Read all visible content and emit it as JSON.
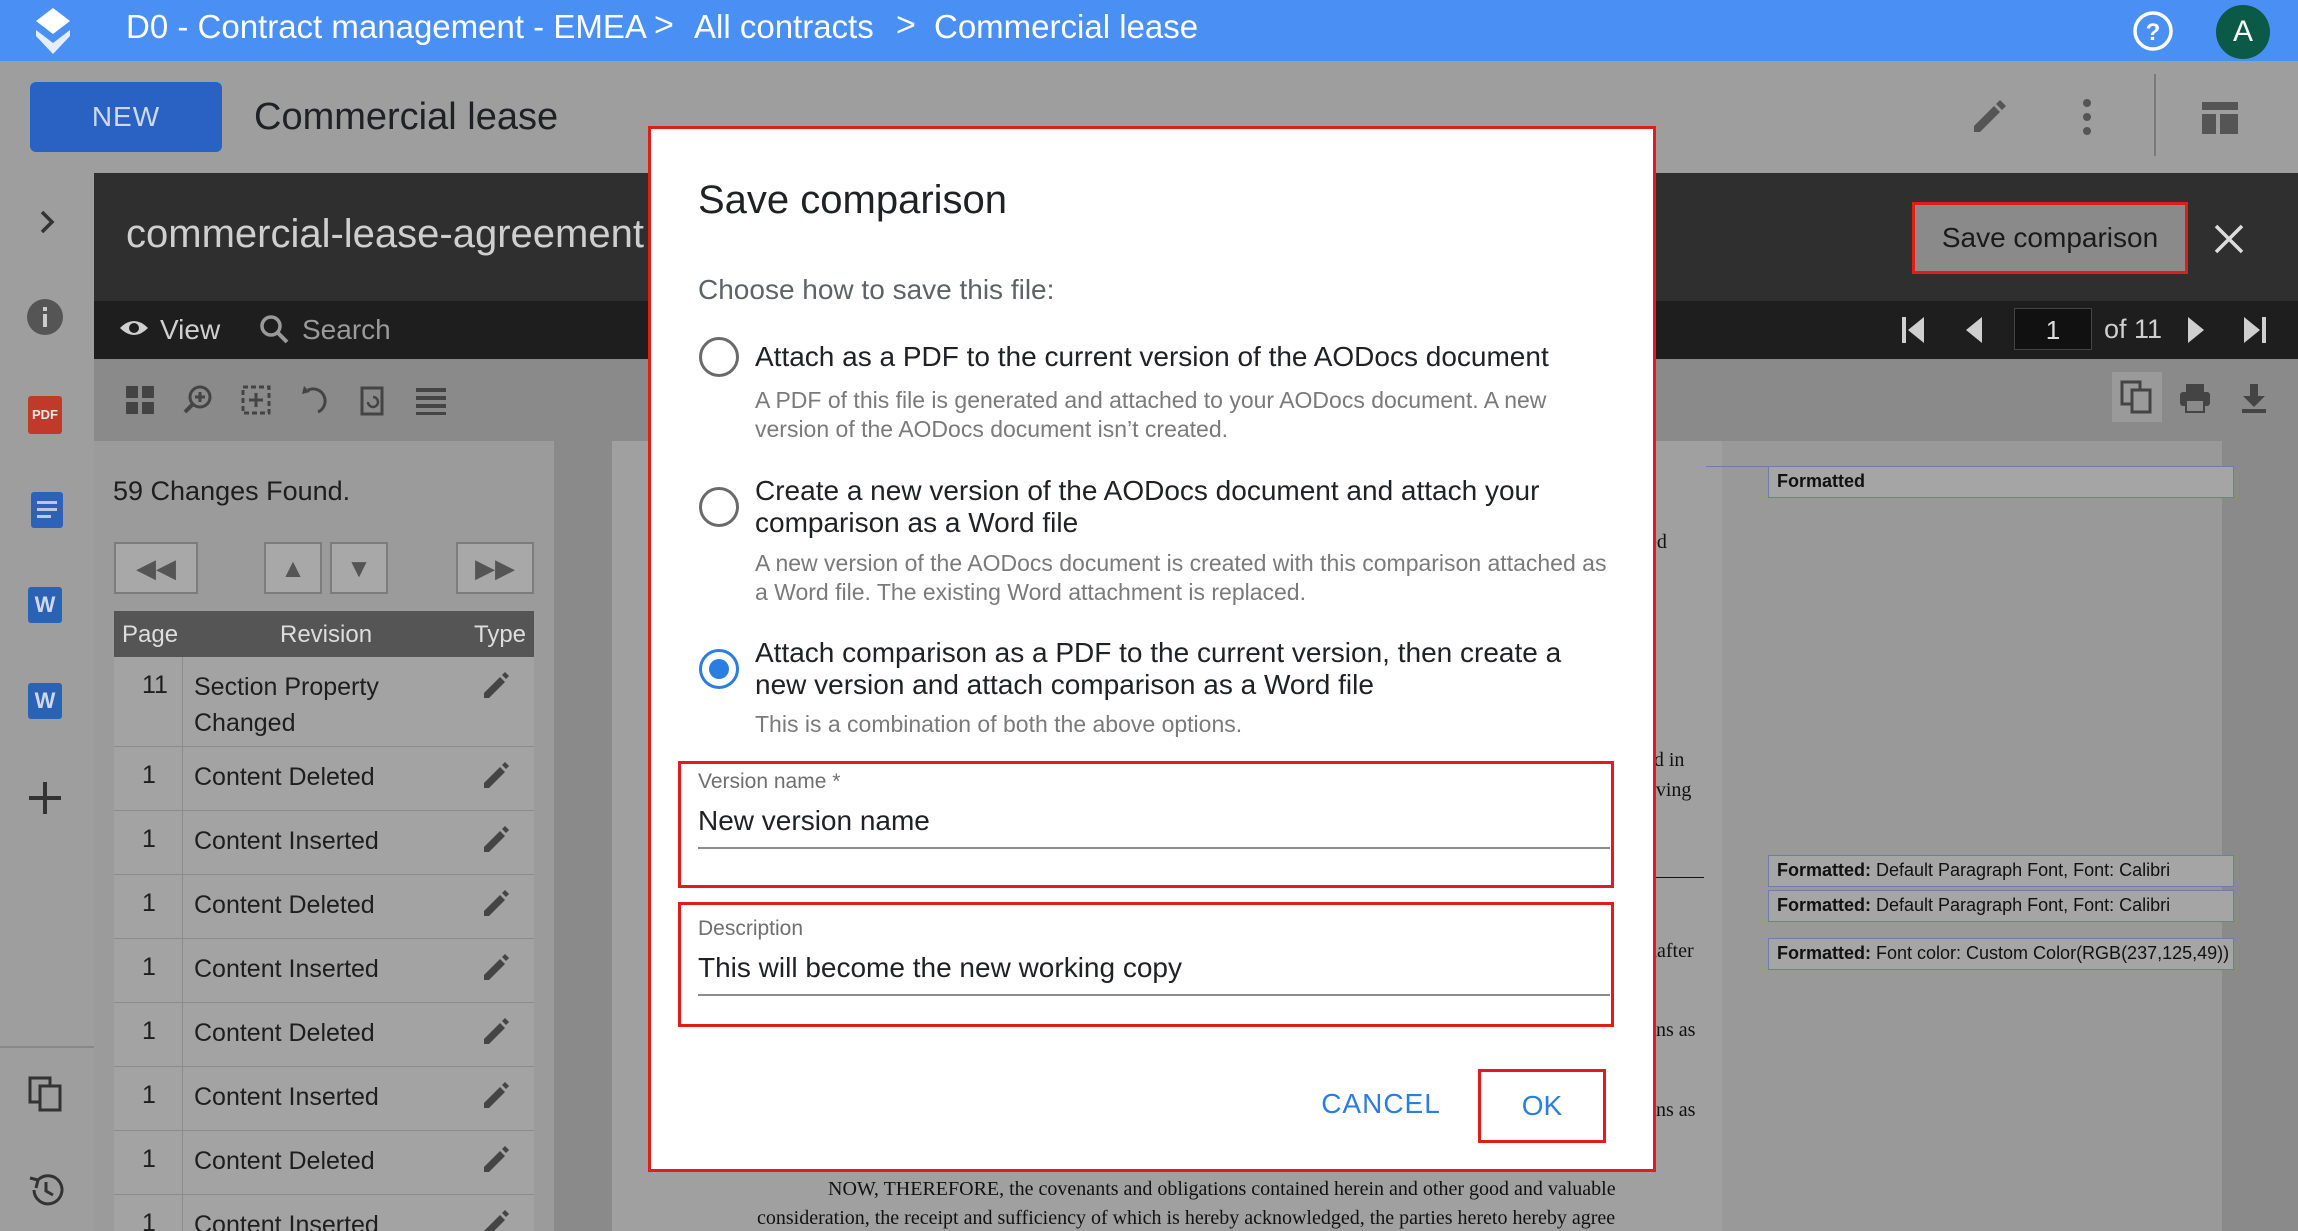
{
  "topbar": {
    "breadcrumbs": [
      "D0 - Contract management - EMEA",
      "All contracts",
      "Commercial lease"
    ],
    "separator": ">",
    "avatar_letter": "A",
    "icons": [
      "app-logo-icon",
      "help-icon"
    ]
  },
  "toolbar": {
    "new_label": "NEW",
    "doc_title": "Commercial lease",
    "icons": [
      "edit-icon",
      "more-vert-icon",
      "layout-icon"
    ]
  },
  "leftrail": {
    "icons": [
      "chevron-right-icon",
      "info-icon",
      "pdf-file-icon",
      "doc-file-icon",
      "word-file-icon",
      "word-file-icon",
      "add-icon",
      "copy-icon",
      "history-icon"
    ],
    "pdf_label": "PDF",
    "word_label": "W"
  },
  "viewer": {
    "file_name": "commercial-lease-agreement",
    "view_label": "View",
    "search_label": "Search",
    "save_comparison_label": "Save comparison",
    "page_current": "1",
    "page_total_label": "of 11"
  },
  "changes": {
    "count_label": "59 Changes Found.",
    "nav": [
      "◀◀",
      "▲",
      "▼",
      "▶▶"
    ],
    "columns": [
      "Page",
      "Revision",
      "Type"
    ],
    "rows": [
      {
        "page": "11",
        "revision": "Section Property Changed"
      },
      {
        "page": "1",
        "revision": "Content Deleted"
      },
      {
        "page": "1",
        "revision": "Content Inserted"
      },
      {
        "page": "1",
        "revision": "Content Deleted"
      },
      {
        "page": "1",
        "revision": "Content Inserted"
      },
      {
        "page": "1",
        "revision": "Content Deleted"
      },
      {
        "page": "1",
        "revision": "Content Inserted"
      },
      {
        "page": "1",
        "revision": "Content Deleted"
      },
      {
        "page": "1",
        "revision": "Content Inserted"
      }
    ]
  },
  "document": {
    "balloons": [
      {
        "bold": "Formatted",
        "text": ""
      },
      {
        "bold": "Formatted:",
        "text": " Default Paragraph Font, Font: Calibri"
      },
      {
        "bold": "Formatted:",
        "text": " Default Paragraph Font, Font: Calibri"
      },
      {
        "bold": "Formatted:",
        "text": " Font color: Custom Color(RGB(237,125,49))"
      }
    ],
    "fragments": [
      "ed",
      "ed  in",
      "aving",
      "hafter",
      "ons as",
      "ons as"
    ],
    "bottom_lines": [
      "NOW, THEREFORE, the covenants and obligations contained herein and other good and valuable",
      "consideration, the receipt and sufficiency of which is hereby acknowledged, the parties hereto hereby agree"
    ]
  },
  "dialog": {
    "title": "Save comparison",
    "prompt": "Choose how to save this file:",
    "options": [
      {
        "title": "Attach as a PDF to the current version of the AODocs document",
        "desc": "A PDF of this file is generated and attached to your AODocs document. A new version of the AODocs document isn’t created.",
        "selected": false
      },
      {
        "title": "Create a new version of the AODocs document and attach your comparison as a Word file",
        "desc": "A new version of the AODocs document is created with this comparison attached as a Word file. The existing Word attachment is replaced.",
        "selected": false
      },
      {
        "title": "Attach comparison as a PDF to the current version, then create a new version and attach comparison as a Word file",
        "desc": "This is a combination of both the above options.",
        "selected": true
      }
    ],
    "version_name": {
      "label": "Version name *",
      "value": "New version name"
    },
    "description": {
      "label": "Description",
      "value": "This will become the new working copy"
    },
    "cancel_label": "CANCEL",
    "ok_label": "OK"
  },
  "colors": {
    "topbar": "#4a8ff4",
    "accent": "#2a7de1",
    "highlight": "#e21b1b",
    "avatar": "#0b5a47"
  }
}
